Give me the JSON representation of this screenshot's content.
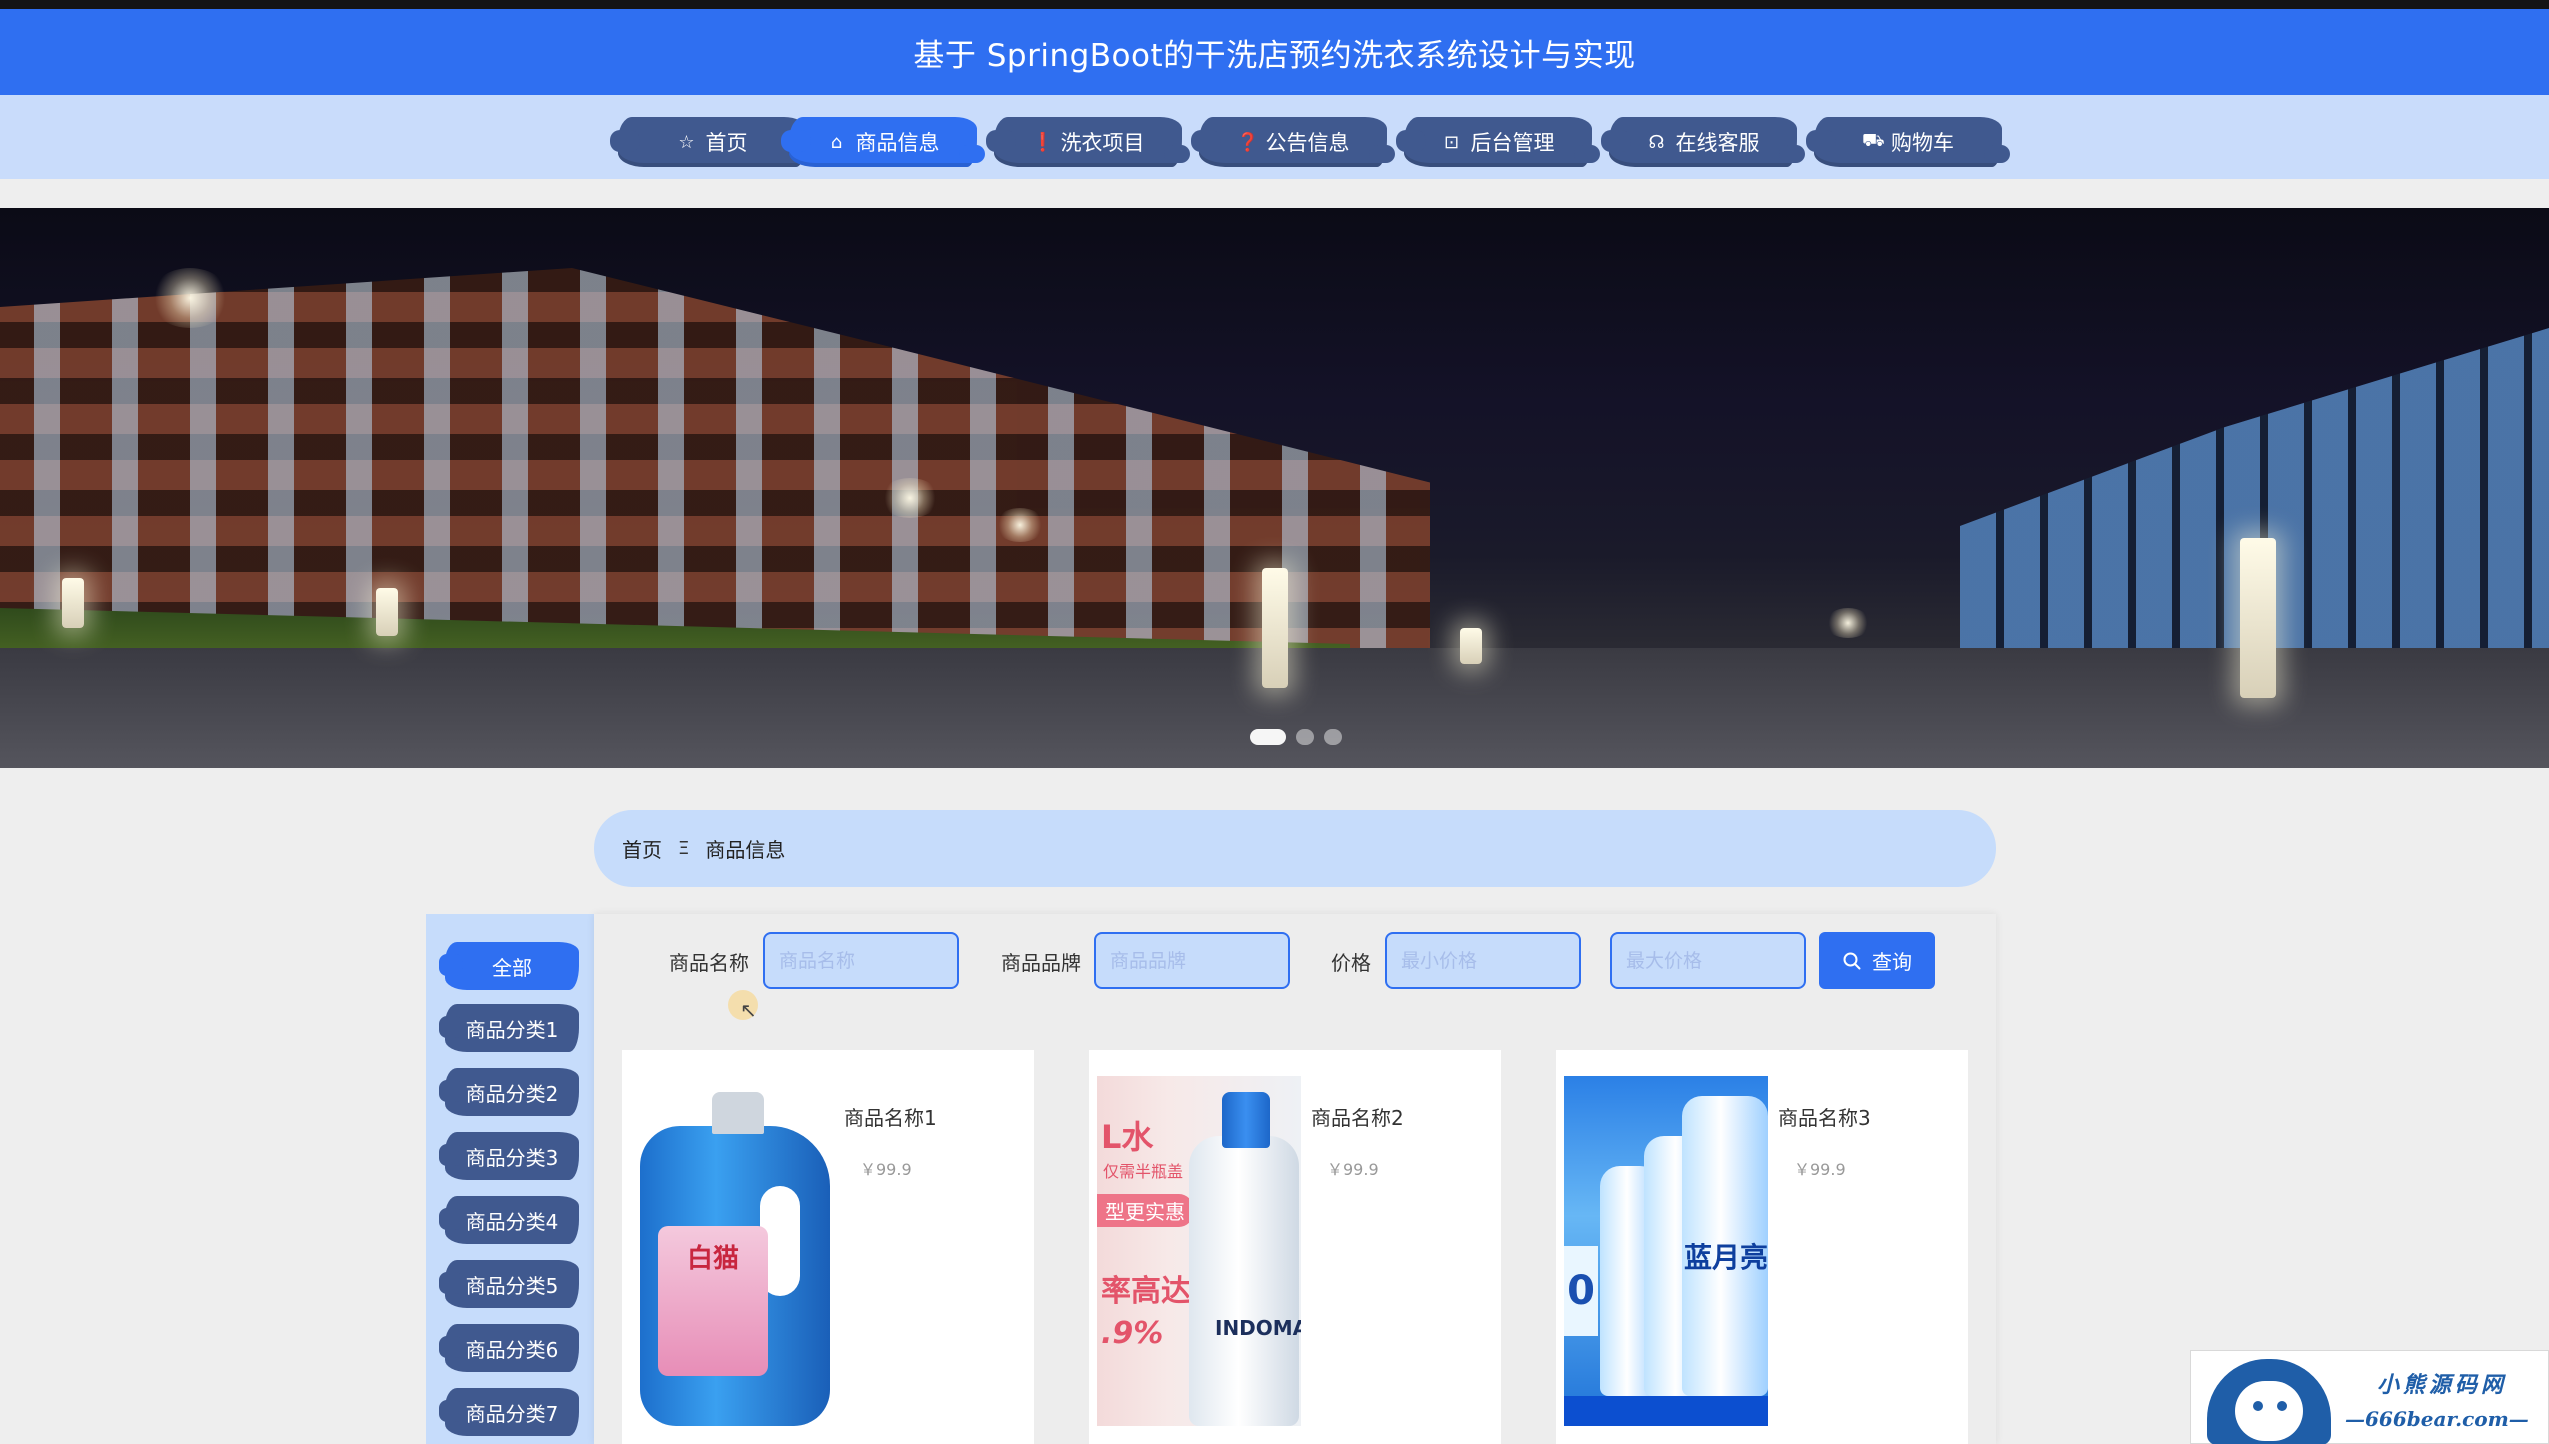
{
  "header": {
    "title": "基于 SpringBoot的干洗店预约洗衣系统设计与实现"
  },
  "nav": {
    "items": [
      {
        "label": "首页",
        "icon": "star-icon",
        "glyph": "☆"
      },
      {
        "label": "商品信息",
        "icon": "shopping-bag-icon",
        "glyph": "⌂"
      },
      {
        "label": "洗衣项目",
        "icon": "info-circle-icon",
        "glyph": "❗"
      },
      {
        "label": "公告信息",
        "icon": "question-circle-icon",
        "glyph": "❓"
      },
      {
        "label": "后台管理",
        "icon": "briefcase-icon",
        "glyph": "⊡"
      },
      {
        "label": "在线客服",
        "icon": "headset-icon",
        "glyph": "☊"
      },
      {
        "label": "购物车",
        "icon": "cart-icon",
        "glyph": "⛟"
      }
    ],
    "active_index": 1
  },
  "banner": {
    "slide_count": 3,
    "active_slide": 0
  },
  "breadcrumb": {
    "home": "首页",
    "separator": "Ξ",
    "current": "商品信息"
  },
  "categories": {
    "items": [
      "全部",
      "商品分类1",
      "商品分类2",
      "商品分类3",
      "商品分类4",
      "商品分类5",
      "商品分类6",
      "商品分类7"
    ],
    "active_index": 0
  },
  "search": {
    "name_label": "商品名称",
    "name_placeholder": "商品名称",
    "brand_label": "商品品牌",
    "brand_placeholder": "商品品牌",
    "price_label": "价格",
    "min_price_placeholder": "最小价格",
    "max_price_placeholder": "最大价格",
    "button_label": "查询",
    "button_icon": "search-icon"
  },
  "products": [
    {
      "name": "商品名称1",
      "price": "￥99.9",
      "image_text": [
        "白猫"
      ]
    },
    {
      "name": "商品名称2",
      "price": "￥99.9",
      "image_text": [
        "L水",
        "仅需半瓶盖",
        "型更实惠",
        "率高达",
        ".9%",
        "INDOMAS"
      ]
    },
    {
      "name": "商品名称3",
      "price": "￥99.9",
      "image_text": [
        "蓝月亮",
        "0"
      ]
    }
  ],
  "watermark": {
    "title": "小熊源码网",
    "url": "—666bear.com—"
  },
  "colors": {
    "primary": "#2f6ff1",
    "nav_bg": "#c9dcfb",
    "brush_dark": "#40598f",
    "page_bg": "#eeeeee"
  }
}
